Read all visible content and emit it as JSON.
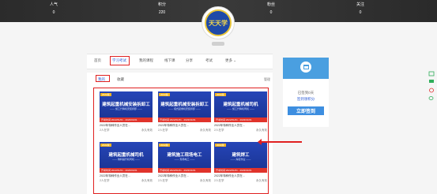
{
  "stats": [
    {
      "label": "人气",
      "value": "0"
    },
    {
      "label": "积分",
      "value": "220"
    },
    {
      "label": "粉丝",
      "value": "0"
    },
    {
      "label": "关注",
      "value": "0"
    }
  ],
  "avatar_text": "天天学",
  "nav": {
    "items": [
      "首页",
      "学习考试",
      "我的课程",
      "线下课",
      "分享",
      "考试",
      "更多"
    ]
  },
  "tabs": [
    "我的",
    "收藏"
  ],
  "manage_label": "管理",
  "sign": {
    "days_text": "已签到0天",
    "points_text": "签到领积分",
    "button": "立即签到"
  },
  "cards": [
    {
      "tag": "2022版",
      "title": "建筑起重机械安装拆卸工",
      "subtitle": "—— 施工升降机安装拆卸 ——",
      "bar": "开考时间:2022/01/01 - 2023/01/01",
      "desc": "2022年特种作业人员在...",
      "learners": "2人在学",
      "validity": "永久有效"
    },
    {
      "tag": "2022版",
      "title": "建筑起重机械安装拆卸工",
      "subtitle": "—— 塔式起重机安装拆卸 ——",
      "bar": "开考时间:2022/01/01 - 2023/01/01",
      "desc": "2022年特种作业人员在...",
      "learners": "2人在学",
      "validity": "永久有效"
    },
    {
      "tag": "2022版",
      "title": "建筑起重机械司机",
      "subtitle": "—— 施工升降机司机 ——",
      "bar": "开考时间:2022/01/01 - 2023/01/01",
      "desc": "2022年特种作业人员在...",
      "learners": "2人在学",
      "validity": "永久有效"
    },
    {
      "tag": "2022版",
      "title": "建筑起重机械司机",
      "subtitle": "—— 物料提升机司机 ——",
      "bar": "开考时间:2022/01/01 - 2023/01/01",
      "desc": "2022年特种作业人员在...",
      "learners": "2人在学",
      "validity": "永久有效"
    },
    {
      "tag": "2022版",
      "title": "建筑施工现场电工",
      "subtitle": "—— 现场电工 ——",
      "bar": "开考时间:2022/01/01 - 2023/01/01",
      "desc": "2022年特种作业人员在...",
      "learners": "2人在学",
      "validity": "永久有效"
    },
    {
      "tag": "2022版",
      "title": "建筑焊工",
      "subtitle": "—— 焊接作业 ——",
      "bar": "开考时间:2022/01/01 - 2023/01/01",
      "desc": "2022年特种作业人员在...",
      "learners": "2人在学",
      "validity": "永久有效"
    }
  ],
  "colors": {
    "accent": "#2a5bd7",
    "highlight": "#e02020",
    "sign_header": "#4a9fe0",
    "banner": "#2b2b2b"
  },
  "float_icons": [
    "calendar-icon",
    "message-icon",
    "share-icon",
    "wechat-icon"
  ]
}
